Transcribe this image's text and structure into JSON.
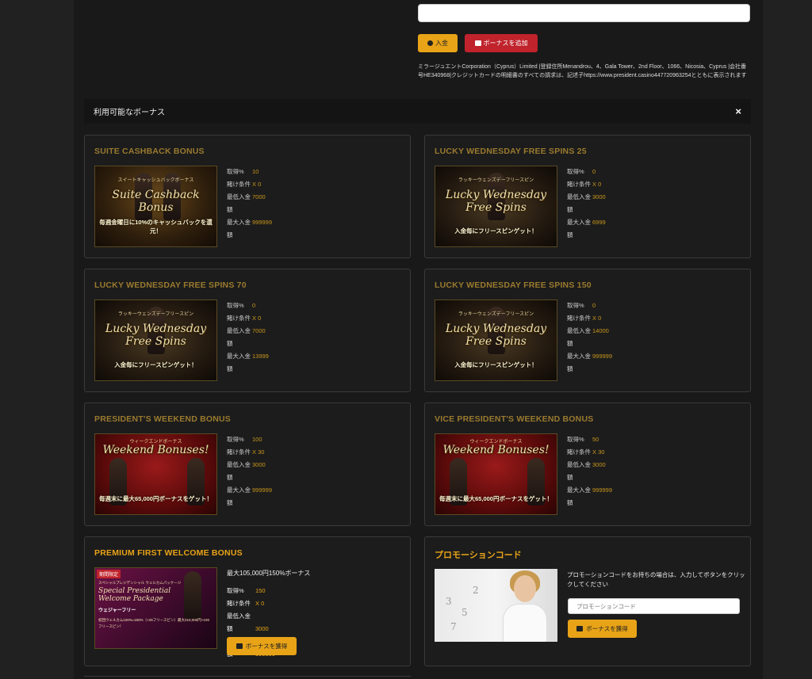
{
  "header": {
    "deposit_label": "入金",
    "add_bonus_label": "ボーナスを追加",
    "legal_text": "ミラージュエントCorporation（Cyprus）Limited |登録住所Menandrou、4、Gala Tower、2nd Floor、1066、Nicosia、Cyprus |会社番号HE340968|クレジットカードの明細書のすべての請求は、記述子https://www.president.casino447720963254とともに表示されます"
  },
  "bonus_panel": {
    "title": "利用可能なボーナス",
    "close": "×"
  },
  "labels": {
    "percent": "取得%",
    "wager": "賭け条件",
    "min_deposit": "最低入金額",
    "max_deposit": "最大入金額"
  },
  "cards": [
    {
      "title": "SUITE CASHBACK BONUS",
      "banner": {
        "top": "スイートキャッシュバックボーナス",
        "main": "Suite Cashback Bonus",
        "bottom": "毎週金曜日に10%のキャッシュバックを還元！"
      },
      "percent": "10",
      "wager": "X 0",
      "min": "7000",
      "max": "999999"
    },
    {
      "title": "LUCKY WEDNESDAY FREE SPINS 25",
      "banner": {
        "top": "ラッキーウェンズデーフリースピン",
        "main": "Lucky Wednesday Free Spins",
        "bottom": "入金毎にフリースピンゲット！"
      },
      "percent": "0",
      "wager": "X 0",
      "min": "3000",
      "max": "6999"
    },
    {
      "title": "LUCKY WEDNESDAY FREE SPINS 70",
      "banner": {
        "top": "ラッキーウェンズデーフリースピン",
        "main": "Lucky Wednesday Free Spins",
        "bottom": "入金毎にフリースピンゲット！"
      },
      "percent": "0",
      "wager": "X 0",
      "min": "7000",
      "max": "13999"
    },
    {
      "title": "LUCKY WEDNESDAY FREE SPINS 150",
      "banner": {
        "top": "ラッキーウェンズデーフリースピン",
        "main": "Lucky Wednesday Free Spins",
        "bottom": "入金毎にフリースピンゲット！"
      },
      "percent": "0",
      "wager": "X 0",
      "min": "14000",
      "max": "999999"
    },
    {
      "title": "PRESIDENT'S WEEKEND BONUS",
      "banner": {
        "top": "ウィークエンドボーナス",
        "main": "Weekend Bonuses!",
        "bottom": "毎週末に最大65,000円ボーナスをゲット！"
      },
      "percent": "100",
      "wager": "X 30",
      "min": "3000",
      "max": "999999"
    },
    {
      "title": "VICE PRESIDENT'S WEEKEND BONUS",
      "banner": {
        "top": "ウィークエンドボーナス",
        "main": "Weekend Bonuses!",
        "bottom": "毎週末に最大65,000円ボーナスをゲット！"
      },
      "percent": "50",
      "wager": "X 30",
      "min": "3000",
      "max": "999999"
    }
  ],
  "premium": {
    "title": "PREMIUM FIRST WELCOME BONUS",
    "banner": {
      "tag": "期間限定",
      "top": "スペシャルプレジデンシャル ウェルカムパッケージ",
      "main": "Special Presidential Welcome Package",
      "sub": "ウェジャーフリー",
      "bottom": "初回ウェルカム100%♪150%（+25フリースピン）最大210,000円+100フリースピン！"
    },
    "subtitle": "最大105,000円150%ボーナス",
    "percent": "150",
    "wager": "X 0",
    "min": "3000",
    "max": "999999",
    "button": "ボーナスを獲得"
  },
  "promo": {
    "title": "プロモーションコード",
    "description": "プロモーションコードをお持ちの場合は、入力してボタンをクリックしてください",
    "placeholder": "プロモーションコード",
    "button": "ボーナスを獲得"
  },
  "colors": {
    "accent": "#e8a317",
    "danger": "#c0232c",
    "title_dim": "#9a7a2e"
  }
}
